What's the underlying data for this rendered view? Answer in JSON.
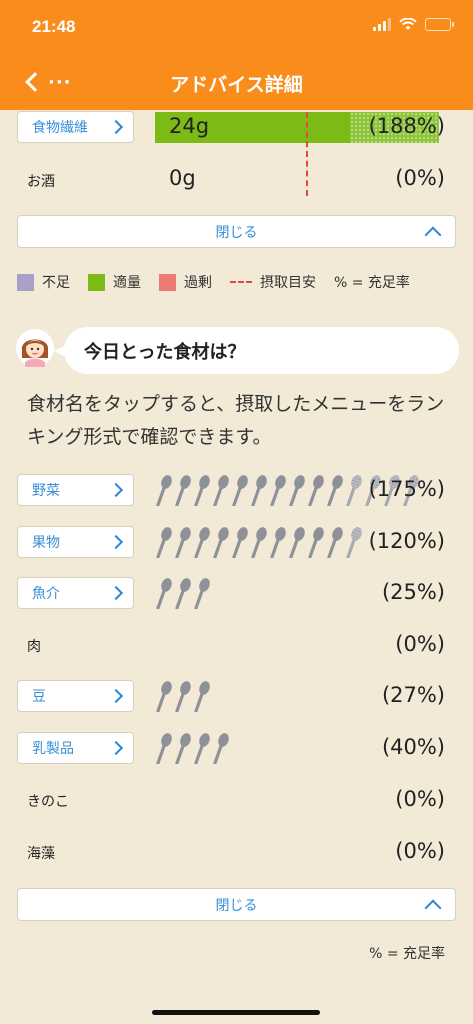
{
  "status": {
    "time": "21:48"
  },
  "nav": {
    "back_dots": "···",
    "title": "アドバイス詳細"
  },
  "nutrients": [
    {
      "label": "食物繊維",
      "value": "24g",
      "percent": "(188%)",
      "fill_fraction": 1.0,
      "target_fraction": 0.53
    },
    {
      "label": "お酒",
      "value": "0g",
      "percent": "(0%)"
    }
  ],
  "close_label": "閉じる",
  "legend": {
    "shortage": {
      "label": "不足",
      "color": "#a9a0c9"
    },
    "adequate": {
      "label": "適量",
      "color": "#7cba16"
    },
    "excess": {
      "label": "過剰",
      "color": "#ec7b74"
    },
    "target": {
      "label": "摂取目安",
      "color": "#e14747"
    },
    "percent_note": "% = 充足率"
  },
  "question": "今日とった食材は？",
  "description": "食材名をタップすると、摂取したメニューをランキング形式で確認できます。",
  "foods": [
    {
      "label": "野菜",
      "percent": "(175%)",
      "link": true,
      "full_spoons": 10,
      "excess_spoons": 4
    },
    {
      "label": "果物",
      "percent": "(120%)",
      "link": true,
      "full_spoons": 10,
      "excess_spoons": 1
    },
    {
      "label": "魚介",
      "percent": "(25%)",
      "link": true,
      "full_spoons": 3,
      "excess_spoons": 0
    },
    {
      "label": "肉",
      "percent": "(0%)",
      "link": false,
      "full_spoons": 0,
      "excess_spoons": 0
    },
    {
      "label": "豆",
      "percent": "(27%)",
      "link": true,
      "full_spoons": 3,
      "excess_spoons": 0
    },
    {
      "label": "乳製品",
      "percent": "(40%)",
      "link": true,
      "full_spoons": 4,
      "excess_spoons": 0
    },
    {
      "label": "きのこ",
      "percent": "(0%)",
      "link": false,
      "full_spoons": 0,
      "excess_spoons": 0
    },
    {
      "label": "海藻",
      "percent": "(0%)",
      "link": false,
      "full_spoons": 0,
      "excess_spoons": 0
    }
  ],
  "footer_note": "% = 充足率"
}
